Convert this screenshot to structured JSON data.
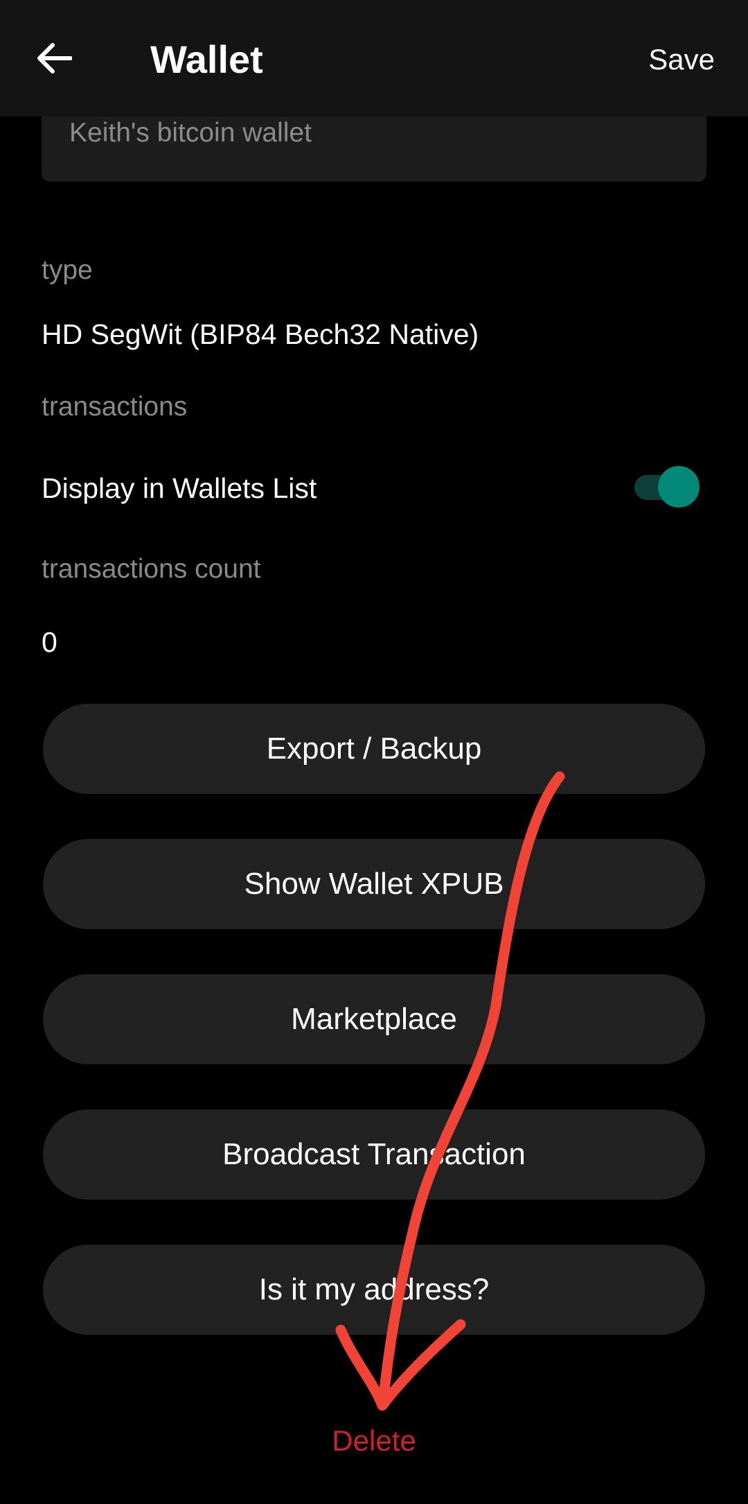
{
  "header": {
    "title": "Wallet",
    "save_label": "Save",
    "back_icon": "arrow-left-icon"
  },
  "wallet_name": {
    "value": "Keith's bitcoin wallet"
  },
  "type": {
    "label": "type",
    "value": "HD SegWit (BIP84 Bech32 Native)"
  },
  "transactions": {
    "label": "transactions",
    "display_in_list_label": "Display in Wallets List",
    "display_in_list_enabled": true
  },
  "transactions_count": {
    "label": "transactions count",
    "value": "0"
  },
  "buttons": [
    {
      "label": "Export / Backup"
    },
    {
      "label": "Show Wallet XPUB"
    },
    {
      "label": "Marketplace"
    },
    {
      "label": "Broadcast Transaction"
    },
    {
      "label": "Is it my address?"
    }
  ],
  "delete_label": "Delete",
  "colors": {
    "header_bg": "#141414",
    "toggle_on": "#008878",
    "delete": "#d0202a",
    "annotation": "#f04436"
  }
}
